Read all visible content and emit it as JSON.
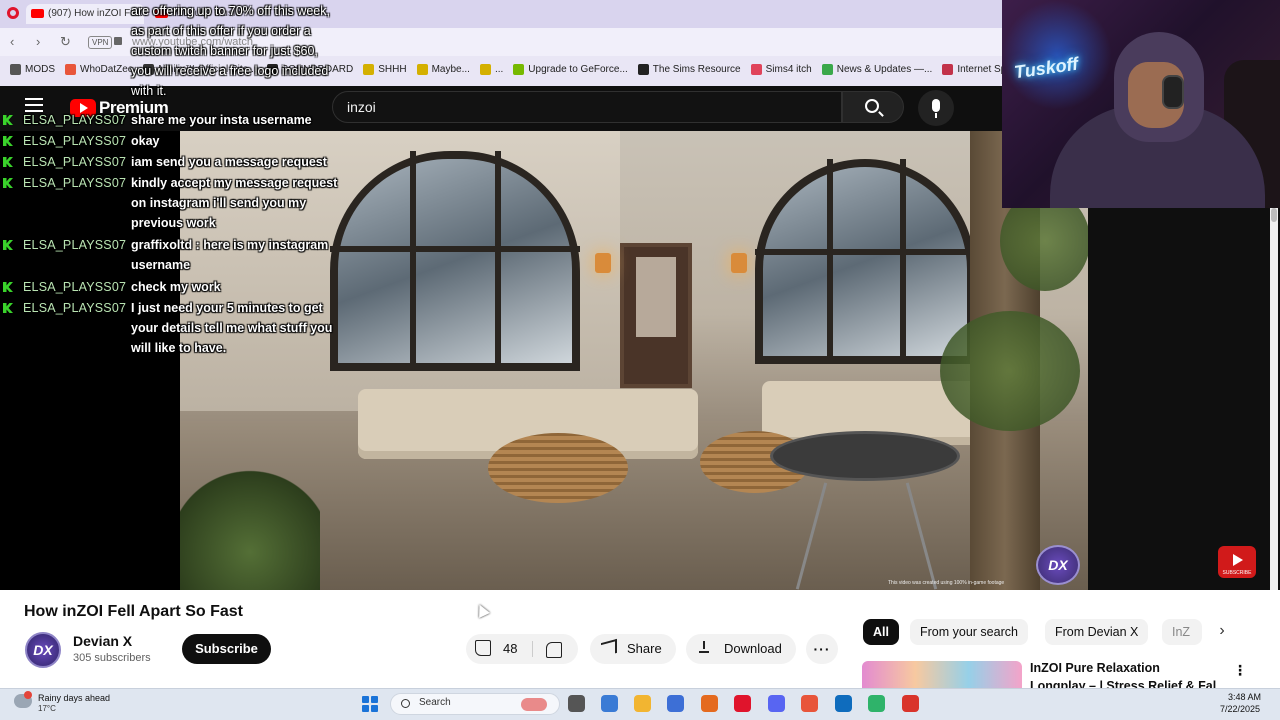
{
  "browser": {
    "tabs": [
      {
        "label": "(907) How inZOI Fell..."
      },
      {
        "label": "YouTube Music"
      }
    ],
    "url": "www.youtube.com/watch",
    "vpn_label": "VPN",
    "bookmarks": [
      {
        "label": "MODS",
        "color": "#555555"
      },
      {
        "label": "WhoDatZee",
        "color": "#e8553a"
      },
      {
        "label": "Nihilix™ Official Site...",
        "color": "#333333"
      },
      {
        "label": "SOUNDBOARD",
        "color": "#222222"
      },
      {
        "label": "SHHH",
        "color": "#d4b000"
      },
      {
        "label": "Maybe...",
        "color": "#d4b000"
      },
      {
        "label": "...",
        "color": "#d4b000"
      },
      {
        "label": "Upgrade to GeForce...",
        "color": "#76b900"
      },
      {
        "label": "The Sims Resource",
        "color": "#222222"
      },
      {
        "label": "Sims4 itch",
        "color": "#e0435a"
      },
      {
        "label": "News & Updates —...",
        "color": "#3aa84a"
      },
      {
        "label": "Internet Speed Test...",
        "color": "#c2324a"
      }
    ]
  },
  "youtube": {
    "logo_text": "Premium",
    "search_value": "inzoi",
    "video_title": "How inZOI Fell Apart So Fast",
    "channel": {
      "avatar": "DX",
      "name": "Devian X",
      "subscribers": "305 subscribers",
      "subscribe_label": "Subscribe"
    },
    "actions": {
      "likes": "48",
      "share_label": "Share",
      "download_label": "Download",
      "more_label": "···"
    },
    "chips": [
      "All",
      "From your search",
      "From Devian X",
      "InZ"
    ],
    "recommendation": {
      "title": "InZOI Pure Relaxation",
      "subtitle": "Longplay – | Stress Relief & Fal"
    },
    "video_badge": "DX",
    "video_footnote": "This video was created using 100% in-game footage",
    "subscribe_watermark": "SUBSCRIBE"
  },
  "chat": {
    "promo": "are offering up to 70% off this week, as part of this offer if you order a custom twitch banner for just $60, you will receive a free logo included with it.",
    "messages": [
      {
        "user": "ELSA_PLAYSS07",
        "text": "share me your insta username"
      },
      {
        "user": "ELSA_PLAYSS07",
        "text": "okay"
      },
      {
        "user": "ELSA_PLAYSS07",
        "text": "iam send you a message request"
      },
      {
        "user": "ELSA_PLAYSS07",
        "text": "kindly accept my message request on instagram i'll send you my previous work"
      },
      {
        "user": "ELSA_PLAYSS07",
        "text": "graffixoltd : here is my instagram username"
      },
      {
        "user": "ELSA_PLAYSS07",
        "text": "check my work"
      },
      {
        "user": "ELSA_PLAYSS07",
        "text": "I just need your 5 minutes to get your details tell me what stuff you will like to have."
      }
    ]
  },
  "webcam": {
    "sign_text": "Tuskoff"
  },
  "taskbar": {
    "weather_line1": "Rainy days ahead",
    "weather_line2": "17°C",
    "search_label": "Search",
    "time": "3:48 AM",
    "date": "7/22/2025",
    "apps": [
      {
        "name": "task-view",
        "color": "#555555"
      },
      {
        "name": "copilot",
        "color": "#3a7bd5"
      },
      {
        "name": "file-explorer",
        "color": "#f2b531"
      },
      {
        "name": "store",
        "color": "#3d6fd6"
      },
      {
        "name": "game-app",
        "color": "#e46a1f"
      },
      {
        "name": "opera",
        "color": "#e0142c"
      },
      {
        "name": "discord",
        "color": "#5865f2"
      },
      {
        "name": "office",
        "color": "#e8553a"
      },
      {
        "name": "outlook",
        "color": "#0f6cbd"
      },
      {
        "name": "android-app",
        "color": "#2fb36a"
      },
      {
        "name": "media-app",
        "color": "#d9342b"
      }
    ]
  }
}
